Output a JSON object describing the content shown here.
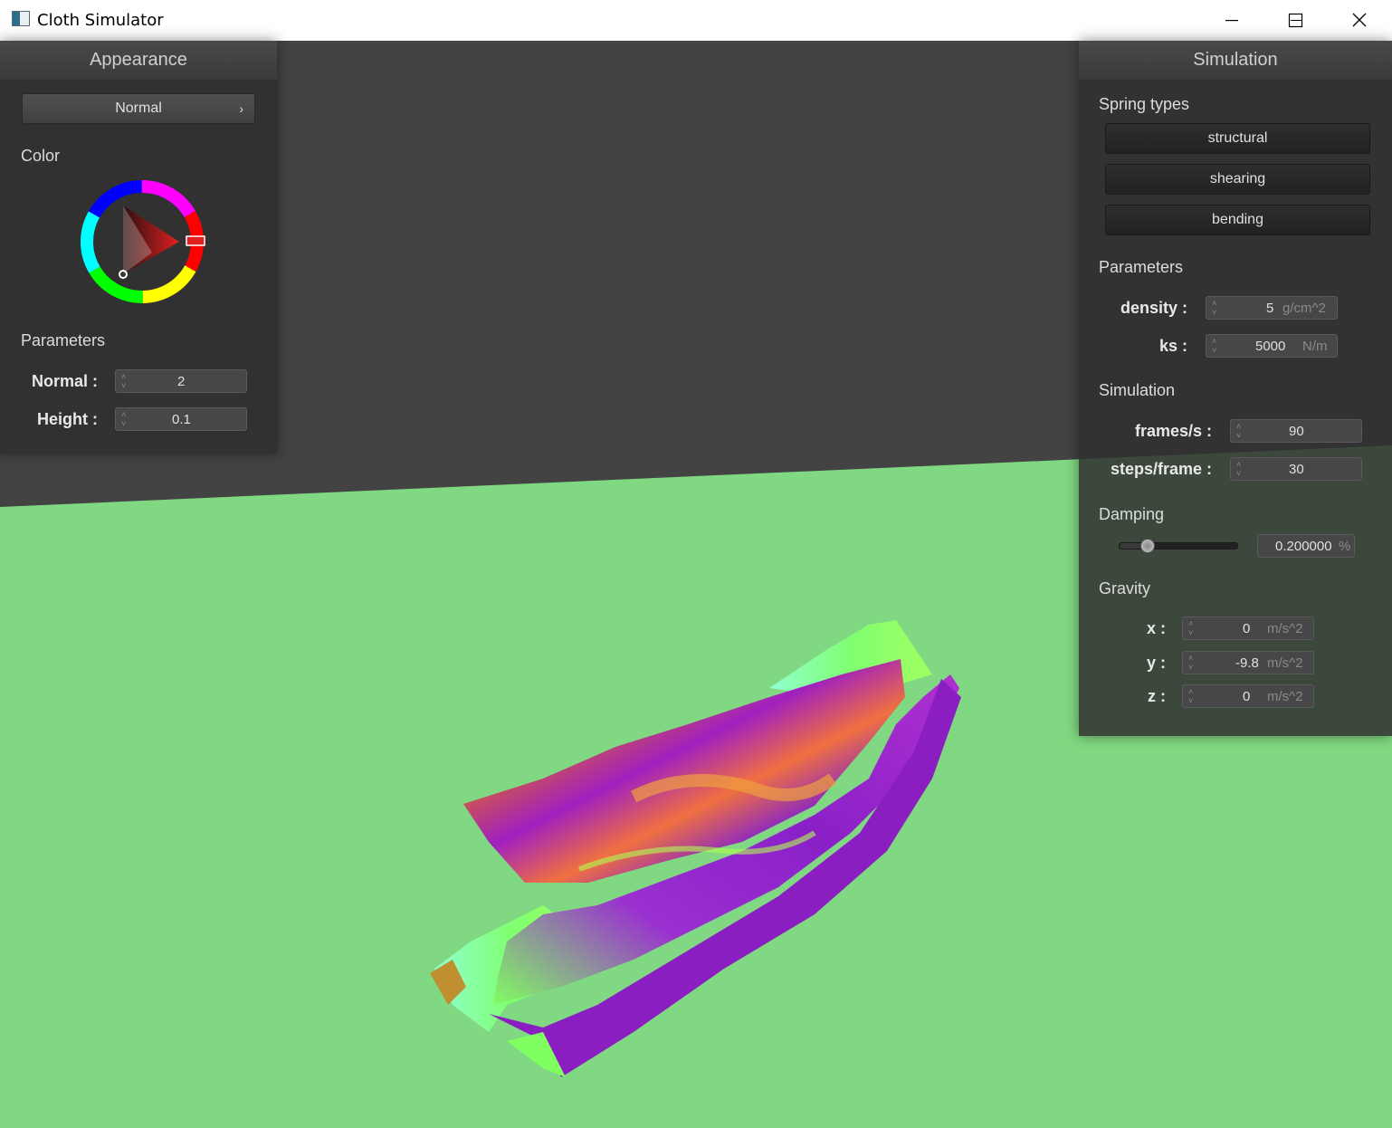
{
  "window": {
    "title": "Cloth Simulator"
  },
  "appearance": {
    "title": "Appearance",
    "shader_dropdown": {
      "value": "Normal",
      "arrow": "›"
    },
    "color_label": "Color",
    "selected_color": "#e02020",
    "parameters_label": "Parameters",
    "normal": {
      "label": "Normal :",
      "value": "2"
    },
    "height": {
      "label": "Height :",
      "value": "0.1"
    }
  },
  "simulation": {
    "title": "Simulation",
    "spring_types_label": "Spring types",
    "springs": [
      "structural",
      "shearing",
      "bending"
    ],
    "parameters_label": "Parameters",
    "density": {
      "label": "density :",
      "value": "5",
      "unit": "g/cm^2"
    },
    "ks": {
      "label": "ks :",
      "value": "5000",
      "unit": "N/m"
    },
    "simulation_label": "Simulation",
    "frames": {
      "label": "frames/s :",
      "value": "90"
    },
    "steps": {
      "label": "steps/frame :",
      "value": "30"
    },
    "damping_label": "Damping",
    "damping": {
      "value": "0.200000",
      "unit": "%",
      "level": 0.2
    },
    "gravity_label": "Gravity",
    "gravity": [
      {
        "label": "x :",
        "value": "0",
        "unit": "m/s^2"
      },
      {
        "label": "y :",
        "value": "-9.8",
        "unit": "m/s^2"
      },
      {
        "label": "z :",
        "value": "0",
        "unit": "m/s^2"
      }
    ]
  },
  "scene": {
    "floor_color": "#80d982",
    "background_color": "#434343"
  }
}
